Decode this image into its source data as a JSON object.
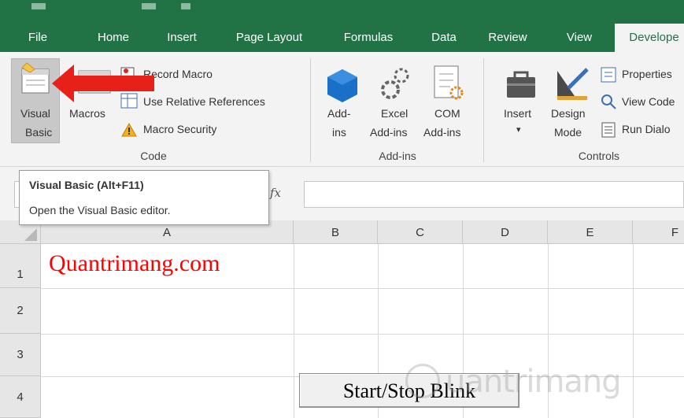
{
  "tabs": [
    "File",
    "Home",
    "Insert",
    "Page Layout",
    "Formulas",
    "Data",
    "Review",
    "View",
    "Develope"
  ],
  "active_tab": "Develope",
  "ribbon": {
    "code": {
      "visual_basic_line1": "Visual",
      "visual_basic_line2": "Basic",
      "macros": "Macros",
      "record_macro": "Record Macro",
      "use_relative_references": "Use Relative References",
      "macro_security": "Macro Security",
      "group_label": "Code"
    },
    "addins": {
      "addins_line1": "Add-",
      "addins_line2": "ins",
      "excel_addins_line1": "Excel",
      "excel_addins_line2": "Add-ins",
      "com_addins_line1": "COM",
      "com_addins_line2": "Add-ins",
      "group_label": "Add-ins"
    },
    "controls": {
      "insert": "Insert",
      "design_mode_line1": "Design",
      "design_mode_line2": "Mode",
      "properties": "Properties",
      "view_code": "View Code",
      "run_dialog": "Run Dialo",
      "group_label": "Controls"
    }
  },
  "tooltip": {
    "title": "Visual Basic (Alt+F11)",
    "description": "Open the Visual Basic editor."
  },
  "formula_bar": {
    "fx": "fx"
  },
  "sheet": {
    "columns": [
      "A",
      "B",
      "C",
      "D",
      "E",
      "F"
    ],
    "rows": [
      "1",
      "2",
      "3",
      "4"
    ],
    "a1": "Quantrimang.com",
    "button_label": "Start/Stop Blink"
  },
  "watermark": "uantrimang",
  "colors": {
    "excel_green": "#217346",
    "arrow_red": "#e8201a",
    "cell_text_red": "#ff0000"
  }
}
